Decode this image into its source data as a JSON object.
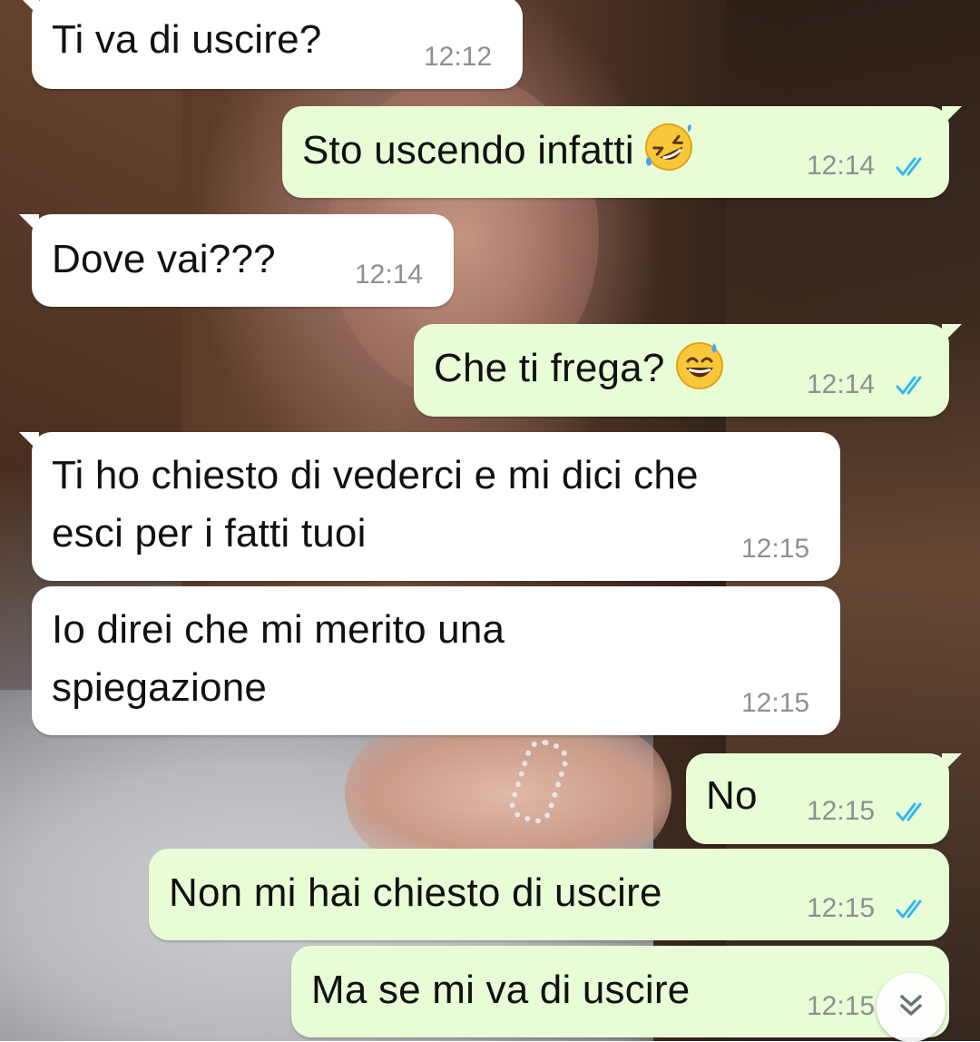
{
  "colors": {
    "incoming_bubble": "#ffffff",
    "outgoing_bubble": "#e8fdd6",
    "timestamp": "#8b9190",
    "read_ticks": "#34b7f1"
  },
  "messages": [
    {
      "direction": "incoming",
      "text": "Ti va di uscire?",
      "time": "12:12"
    },
    {
      "direction": "outgoing",
      "text": "Sto uscendo infatti",
      "emoji": "rolling-on-floor-laughing-emoji",
      "time": "12:14",
      "status": "read"
    },
    {
      "direction": "incoming",
      "text": "Dove vai???",
      "time": "12:14"
    },
    {
      "direction": "outgoing",
      "text": "Che ti frega?",
      "emoji": "grinning-face-with-sweat-emoji",
      "time": "12:14",
      "status": "read"
    },
    {
      "direction": "incoming",
      "text": "Ti ho chiesto di vederci e mi dici che\nesci per i fatti tuoi",
      "time": "12:15"
    },
    {
      "direction": "incoming",
      "text": "Io direi che mi merito una\nspiegazione",
      "time": "12:15"
    },
    {
      "direction": "outgoing",
      "text": "No",
      "time": "12:15",
      "status": "read"
    },
    {
      "direction": "outgoing",
      "text": "Non mi hai chiesto di uscire",
      "time": "12:15",
      "status": "read"
    },
    {
      "direction": "outgoing",
      "text": "Ma se mi va di uscire",
      "time": "12:15",
      "status": "read"
    }
  ],
  "scroll_button": {
    "icon": "double-chevron-down-icon"
  }
}
